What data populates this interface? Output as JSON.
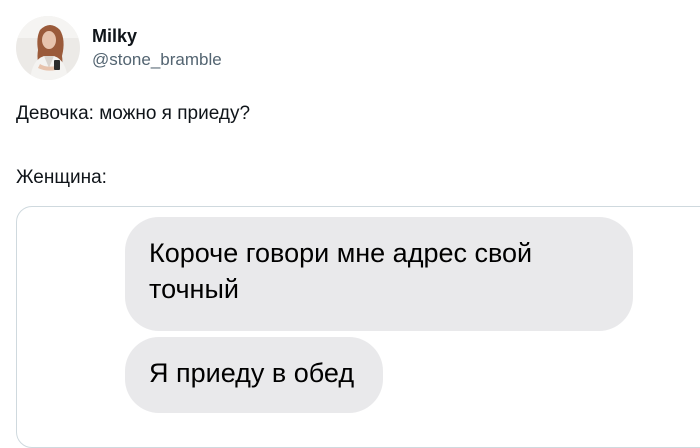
{
  "user": {
    "display_name": "Milky",
    "handle": "@stone_bramble",
    "avatar_icon": "avatar-photo-icon"
  },
  "tweet": {
    "line1": "Девочка: можно я приеду?",
    "line2": "Женщина:"
  },
  "messages": [
    {
      "text": "Короче говори мне адрес свой точный"
    },
    {
      "text": "Я приеду в обед"
    }
  ],
  "colors": {
    "text": "#0f1419",
    "muted": "#536471",
    "card_border": "#cfd9de",
    "bubble_bg": "#e9e9eb"
  }
}
